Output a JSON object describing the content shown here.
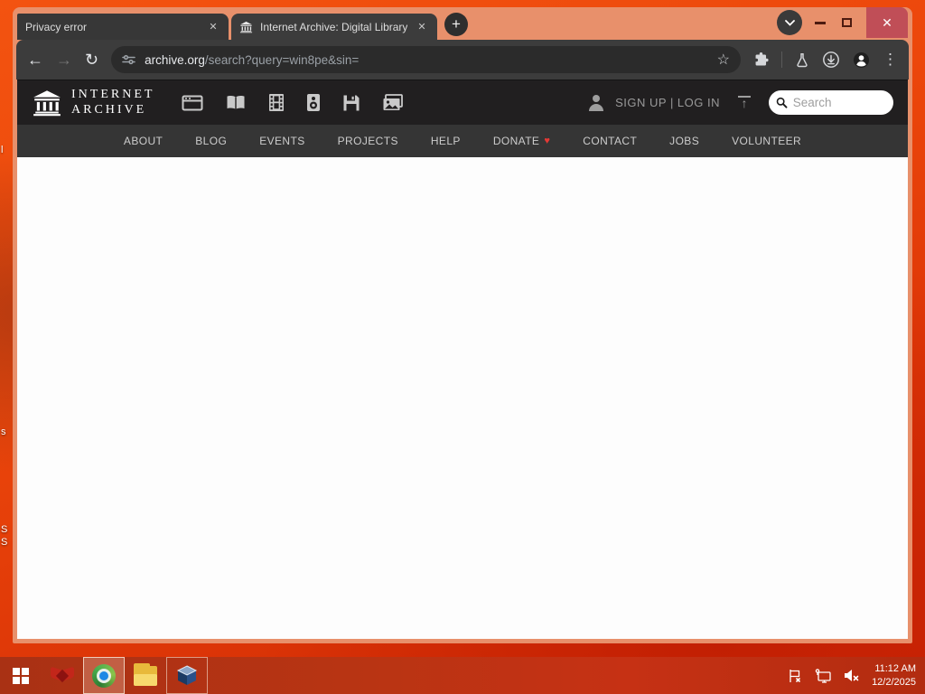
{
  "desktop": {
    "label_fragments": [
      "l",
      "s",
      "S",
      "S"
    ]
  },
  "browser": {
    "tabs": [
      {
        "title": "Privacy error"
      },
      {
        "title": "Internet Archive: Digital Library"
      }
    ],
    "tab_close_glyph": "✕",
    "new_tab_glyph": "+",
    "window_close_glyph": "✕",
    "back_glyph": "←",
    "forward_glyph": "→",
    "reload_glyph": "↻",
    "star_glyph": "☆",
    "kebab_glyph": "⋮",
    "url_domain": "archive.org",
    "url_path": "/search?query=win8pe&sin="
  },
  "ia": {
    "logo_line1": "INTERNET",
    "logo_line2": "ARCHIVE",
    "auth_text": "SIGN UP | LOG IN",
    "upload_arrow": "↑",
    "search_placeholder": "Search",
    "donate_heart": "♥",
    "nav": [
      "ABOUT",
      "BLOG",
      "EVENTS",
      "PROJECTS",
      "HELP",
      "DONATE",
      "CONTACT",
      "JOBS",
      "VOLUNTEER"
    ]
  },
  "taskbar": {
    "time": "11:12 AM",
    "date": "12/2/2025"
  },
  "colors": {
    "desktop_orange": "#ec470b",
    "window_frame": "#e8906b",
    "tab_dark": "#3c3c3c",
    "ia_header": "#211f20",
    "ia_nav": "#353535",
    "taskbar_red": "#b93413",
    "close_button": "#c04e57",
    "donate_heart": "#e53935"
  }
}
